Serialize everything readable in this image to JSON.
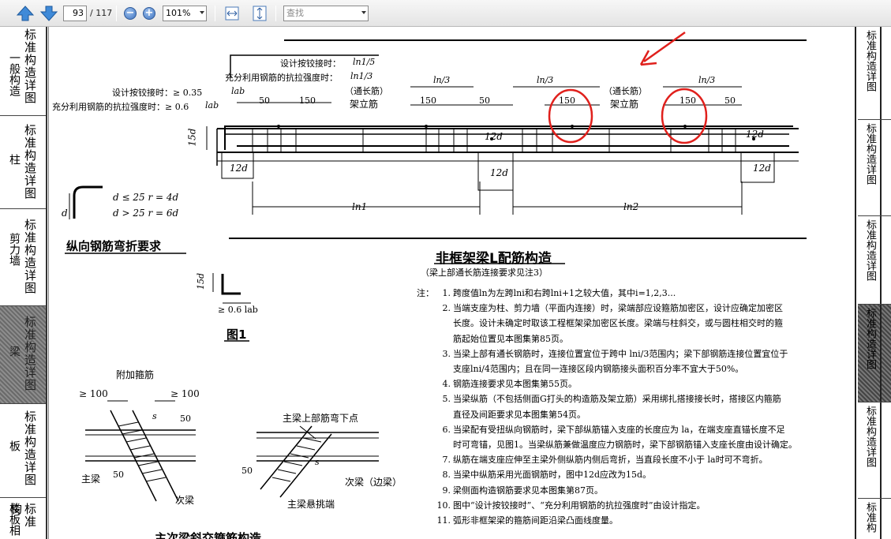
{
  "toolbar": {
    "page_current": "93",
    "page_total": "/ 117",
    "zoom": "101%",
    "find_placeholder": "查找"
  },
  "left_tabs": [
    {
      "sub": "一般构造",
      "main": "标准构造详图"
    },
    {
      "sub": "柱",
      "main": "标准构造详图"
    },
    {
      "sub": "剪力墙",
      "main": "标准构造详图"
    },
    {
      "sub": "梁",
      "main": "标准构造详图"
    },
    {
      "sub": "板",
      "main": "标准构造详图"
    },
    {
      "sub": "楼板相",
      "main": "标准构"
    }
  ],
  "right_tabs": [
    "标准构造详图",
    "标准构造详图",
    "标准构造详图",
    "标准构造详图",
    "标准构造详图",
    "标准构"
  ],
  "drawing": {
    "design_hinge_top": "设计按铰接时：",
    "ln1_5": "ln1/5",
    "full_strength_top": "充分利用钢筋的抗拉强度时：",
    "ln1_3": "ln1/3",
    "design_hinge_left": "设计按铰接时：≥ 0.35",
    "lab": "lab",
    "full_strength_left": "充分利用钢筋的抗拉强度时：≥ 0.6",
    "ln3_a": "ln/3",
    "ln3_b": "ln/3",
    "ln3_c": "ln/3",
    "through_bar_1": "（通长筋）",
    "erect_bar_1": "架立筋",
    "through_bar_2": "（通长筋）",
    "erect_bar_2": "架立筋",
    "dim_50_a": "50",
    "dim_150_a": "150",
    "dim_150_b": "150",
    "dim_50_b": "50",
    "dim_150_c": "150",
    "dim_150_d": "150",
    "dim_50_c": "50",
    "dim_15d": "15d",
    "dim_12d_a": "12d",
    "dim_12d_b": "12d",
    "dim_12d_c": "12d",
    "dim_12d_d": "12d",
    "dim_12d_e": "12d",
    "dim_ln1": "ln1",
    "dim_ln2": "ln2",
    "bend_d_le25": "d ≤ 25   r = 4d",
    "bend_d_gt25": "d > 25   r = 6d",
    "bend_d": "d",
    "bend_title": "纵向钢筋弯折要求",
    "main_title": "非框架梁L配筋构造",
    "main_subtitle": "（梁上部通长筋连接要求见注3）",
    "fig1_15d": "15d",
    "fig1_06lab": "≥ 0.6 lab",
    "fig1_title": "图1",
    "extra_stirrup": "附加箍筋",
    "ge100_a": "≥ 100",
    "ge100_b": "≥ 100",
    "dim_s": "s",
    "dim_50_d": "50",
    "dim_50_e": "50",
    "main_beam": "主梁",
    "secondary_beam": "次梁",
    "main_top_bar_bend": "主梁上部筋弯下点",
    "dim_50_f": "50",
    "dim_s_b": "s",
    "secondary_edge": "次梁（边梁）",
    "main_cantilever": "主梁悬挑端",
    "bottom_title": "主次梁斜交箍筋构造"
  },
  "notes": {
    "label": "注：",
    "items": [
      {
        "num": "1.",
        "lines": [
          "跨度值ln为左跨lni和右跨lni+1之较大值，其中i=1,2,3..."
        ]
      },
      {
        "num": "2.",
        "lines": [
          "当端支座为柱、剪力墙（平面内连接）时，梁端部应设箍筋加密区，设计应确定加密区",
          "长度。设计未确定时取该工程框架梁加密区长度。梁端与柱斜交，或与圆柱相交时的箍",
          "筋起始位置见本图集第85页。"
        ]
      },
      {
        "num": "3.",
        "lines": [
          "当梁上部有通长钢筋时，连接位置宜位于跨中 lni/3范围内；梁下部钢筋连接位置宜位于",
          "支座lni/4范围内；且在同一连接区段内钢筋接头面积百分率不宜大于50%。"
        ]
      },
      {
        "num": "4.",
        "lines": [
          "钢筋连接要求见本图集第55页。"
        ]
      },
      {
        "num": "5.",
        "lines": [
          "当梁纵筋（不包括侧面G打头的构造筋及架立筋）采用绑扎搭接接长时，搭接区内箍筋",
          "直径及间距要求见本图集第54页。"
        ]
      },
      {
        "num": "6.",
        "lines": [
          "当梁配有受扭纵向钢筋时，梁下部纵筋锚入支座的长度应为 la，在端支座直锚长度不足",
          "时可弯锚，见图1。当梁纵筋兼做温度应力钢筋时，梁下部钢筋锚入支座长度由设计确定。"
        ]
      },
      {
        "num": "7.",
        "lines": [
          "纵筋在端支座应伸至主梁外侧纵筋内侧后弯折，当直段长度不小于 la时可不弯折。"
        ]
      },
      {
        "num": "8.",
        "lines": [
          "当梁中纵筋采用光面钢筋时，图中12d应改为15d。"
        ]
      },
      {
        "num": "9.",
        "lines": [
          "梁侧面构造钢筋要求见本图集第87页。"
        ]
      },
      {
        "num": "10.",
        "lines": [
          "图中“设计按铰接时”、“充分利用钢筋的抗拉强度时”由设计指定。"
        ]
      },
      {
        "num": "11.",
        "lines": [
          "弧形非框架梁的箍筋间距沿梁凸面线度量。"
        ]
      }
    ]
  },
  "annotation_color": "#e0201c"
}
